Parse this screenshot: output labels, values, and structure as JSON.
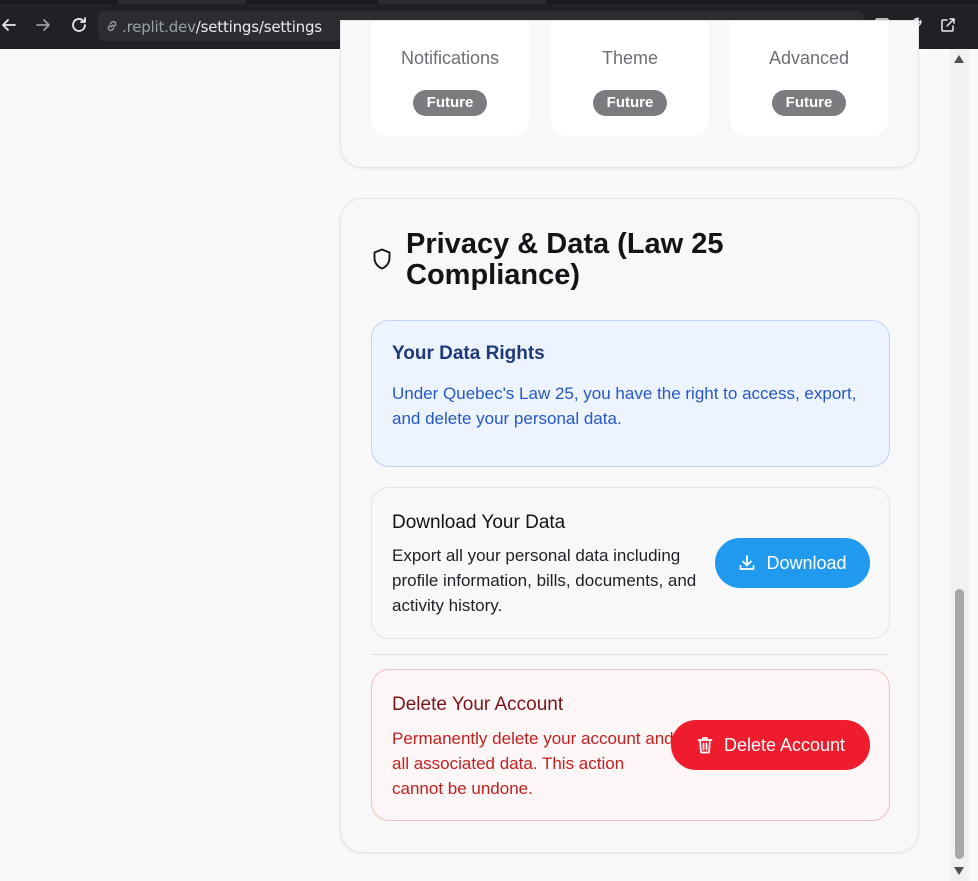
{
  "browser": {
    "url_host": ".replit.dev",
    "url_path": "/settings/settings"
  },
  "preferences": {
    "tiles": [
      {
        "title": "Notifications",
        "badge": "Future"
      },
      {
        "title": "Theme",
        "badge": "Future"
      },
      {
        "title": "Advanced",
        "badge": "Future"
      }
    ]
  },
  "privacy": {
    "title": "Privacy & Data (Law 25 Compliance)",
    "rights": {
      "title": "Your Data Rights",
      "body": "Under Quebec's Law 25, you have the right to access, export, and delete your personal data."
    },
    "download": {
      "title": "Download Your Data",
      "body": "Export all your personal data including profile information, bills, documents, and activity history.",
      "button_label": "Download"
    },
    "delete": {
      "title": "Delete Your Account",
      "body": "Permanently delete your account and all associated data. This action cannot be undone.",
      "button_label": "Delete Account"
    }
  },
  "colors": {
    "download_button": "#1f9aef",
    "delete_button": "#ee1c2c",
    "badge": "#7a7c80"
  },
  "icons": [
    "back-arrow-icon",
    "forward-arrow-icon",
    "reload-icon",
    "link-icon",
    "devices-icon",
    "wrench-icon",
    "open-external-icon",
    "shield-icon",
    "download-icon",
    "trash-icon"
  ]
}
